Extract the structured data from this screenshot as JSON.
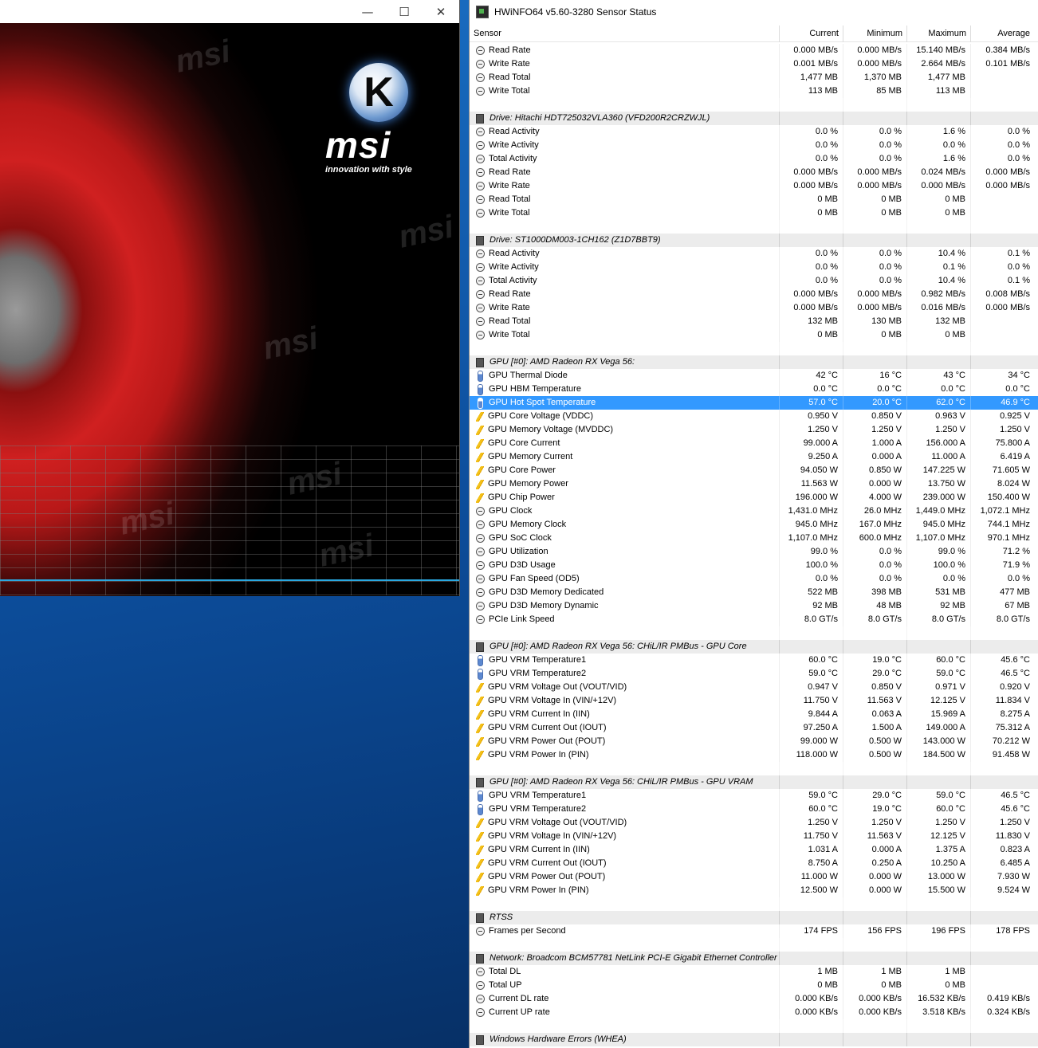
{
  "left_window": {
    "minimize": "—",
    "maximize": "☐",
    "close": "✕",
    "logo_letter": "K",
    "logo_brand": "msi",
    "logo_tagline": "innovation with style",
    "watermark": "msi"
  },
  "hwinfo": {
    "title": "HWiNFO64 v5.60-3280 Sensor Status",
    "columns": [
      "Sensor",
      "Current",
      "Minimum",
      "Maximum",
      "Average"
    ],
    "rows": [
      {
        "t": "s",
        "i": "clock",
        "n": "Read Rate",
        "v": [
          "0.000 MB/s",
          "0.000 MB/s",
          "15.140 MB/s",
          "0.384 MB/s"
        ]
      },
      {
        "t": "s",
        "i": "clock",
        "n": "Write Rate",
        "v": [
          "0.001 MB/s",
          "0.000 MB/s",
          "2.664 MB/s",
          "0.101 MB/s"
        ]
      },
      {
        "t": "s",
        "i": "clock",
        "n": "Read Total",
        "v": [
          "1,477 MB",
          "1,370 MB",
          "1,477 MB",
          ""
        ]
      },
      {
        "t": "s",
        "i": "clock",
        "n": "Write Total",
        "v": [
          "113 MB",
          "85 MB",
          "113 MB",
          ""
        ]
      },
      {
        "t": "b"
      },
      {
        "t": "g",
        "n": "Drive: Hitachi HDT725032VLA360 (VFD200R2CRZWJL)"
      },
      {
        "t": "s",
        "i": "clock",
        "n": "Read Activity",
        "v": [
          "0.0 %",
          "0.0 %",
          "1.6 %",
          "0.0 %"
        ]
      },
      {
        "t": "s",
        "i": "clock",
        "n": "Write Activity",
        "v": [
          "0.0 %",
          "0.0 %",
          "0.0 %",
          "0.0 %"
        ]
      },
      {
        "t": "s",
        "i": "clock",
        "n": "Total Activity",
        "v": [
          "0.0 %",
          "0.0 %",
          "1.6 %",
          "0.0 %"
        ]
      },
      {
        "t": "s",
        "i": "clock",
        "n": "Read Rate",
        "v": [
          "0.000 MB/s",
          "0.000 MB/s",
          "0.024 MB/s",
          "0.000 MB/s"
        ]
      },
      {
        "t": "s",
        "i": "clock",
        "n": "Write Rate",
        "v": [
          "0.000 MB/s",
          "0.000 MB/s",
          "0.000 MB/s",
          "0.000 MB/s"
        ]
      },
      {
        "t": "s",
        "i": "clock",
        "n": "Read Total",
        "v": [
          "0 MB",
          "0 MB",
          "0 MB",
          ""
        ]
      },
      {
        "t": "s",
        "i": "clock",
        "n": "Write Total",
        "v": [
          "0 MB",
          "0 MB",
          "0 MB",
          ""
        ]
      },
      {
        "t": "b"
      },
      {
        "t": "g",
        "n": "Drive: ST1000DM003-1CH162 (Z1D7BBT9)"
      },
      {
        "t": "s",
        "i": "clock",
        "n": "Read Activity",
        "v": [
          "0.0 %",
          "0.0 %",
          "10.4 %",
          "0.1 %"
        ]
      },
      {
        "t": "s",
        "i": "clock",
        "n": "Write Activity",
        "v": [
          "0.0 %",
          "0.0 %",
          "0.1 %",
          "0.0 %"
        ]
      },
      {
        "t": "s",
        "i": "clock",
        "n": "Total Activity",
        "v": [
          "0.0 %",
          "0.0 %",
          "10.4 %",
          "0.1 %"
        ]
      },
      {
        "t": "s",
        "i": "clock",
        "n": "Read Rate",
        "v": [
          "0.000 MB/s",
          "0.000 MB/s",
          "0.982 MB/s",
          "0.008 MB/s"
        ]
      },
      {
        "t": "s",
        "i": "clock",
        "n": "Write Rate",
        "v": [
          "0.000 MB/s",
          "0.000 MB/s",
          "0.016 MB/s",
          "0.000 MB/s"
        ]
      },
      {
        "t": "s",
        "i": "clock",
        "n": "Read Total",
        "v": [
          "132 MB",
          "130 MB",
          "132 MB",
          ""
        ]
      },
      {
        "t": "s",
        "i": "clock",
        "n": "Write Total",
        "v": [
          "0 MB",
          "0 MB",
          "0 MB",
          ""
        ]
      },
      {
        "t": "b"
      },
      {
        "t": "g",
        "n": "GPU [#0]: AMD Radeon RX Vega 56:"
      },
      {
        "t": "s",
        "i": "temp",
        "n": "GPU Thermal Diode",
        "v": [
          "42 °C",
          "16 °C",
          "43 °C",
          "34 °C"
        ]
      },
      {
        "t": "s",
        "i": "temp",
        "n": "GPU HBM Temperature",
        "v": [
          "0.0 °C",
          "0.0 °C",
          "0.0 °C",
          "0.0 °C"
        ]
      },
      {
        "t": "s",
        "i": "temp",
        "n": "GPU Hot Spot Temperature",
        "v": [
          "57.0 °C",
          "20.0 °C",
          "62.0 °C",
          "46.9 °C"
        ],
        "sel": true
      },
      {
        "t": "s",
        "i": "volt",
        "n": "GPU Core Voltage (VDDC)",
        "v": [
          "0.950 V",
          "0.850 V",
          "0.963 V",
          "0.925 V"
        ]
      },
      {
        "t": "s",
        "i": "volt",
        "n": "GPU Memory Voltage (MVDDC)",
        "v": [
          "1.250 V",
          "1.250 V",
          "1.250 V",
          "1.250 V"
        ]
      },
      {
        "t": "s",
        "i": "volt",
        "n": "GPU Core Current",
        "v": [
          "99.000 A",
          "1.000 A",
          "156.000 A",
          "75.800 A"
        ]
      },
      {
        "t": "s",
        "i": "volt",
        "n": "GPU Memory Current",
        "v": [
          "9.250 A",
          "0.000 A",
          "11.000 A",
          "6.419 A"
        ]
      },
      {
        "t": "s",
        "i": "volt",
        "n": "GPU Core Power",
        "v": [
          "94.050 W",
          "0.850 W",
          "147.225 W",
          "71.605 W"
        ]
      },
      {
        "t": "s",
        "i": "volt",
        "n": "GPU Memory Power",
        "v": [
          "11.563 W",
          "0.000 W",
          "13.750 W",
          "8.024 W"
        ]
      },
      {
        "t": "s",
        "i": "volt",
        "n": "GPU Chip Power",
        "v": [
          "196.000 W",
          "4.000 W",
          "239.000 W",
          "150.400 W"
        ]
      },
      {
        "t": "s",
        "i": "clock",
        "n": "GPU Clock",
        "v": [
          "1,431.0 MHz",
          "26.0 MHz",
          "1,449.0 MHz",
          "1,072.1 MHz"
        ]
      },
      {
        "t": "s",
        "i": "clock",
        "n": "GPU Memory Clock",
        "v": [
          "945.0 MHz",
          "167.0 MHz",
          "945.0 MHz",
          "744.1 MHz"
        ]
      },
      {
        "t": "s",
        "i": "clock",
        "n": "GPU SoC Clock",
        "v": [
          "1,107.0 MHz",
          "600.0 MHz",
          "1,107.0 MHz",
          "970.1 MHz"
        ]
      },
      {
        "t": "s",
        "i": "clock",
        "n": "GPU Utilization",
        "v": [
          "99.0 %",
          "0.0 %",
          "99.0 %",
          "71.2 %"
        ]
      },
      {
        "t": "s",
        "i": "clock",
        "n": "GPU D3D Usage",
        "v": [
          "100.0 %",
          "0.0 %",
          "100.0 %",
          "71.9 %"
        ]
      },
      {
        "t": "s",
        "i": "clock",
        "n": "GPU Fan Speed (OD5)",
        "v": [
          "0.0 %",
          "0.0 %",
          "0.0 %",
          "0.0 %"
        ]
      },
      {
        "t": "s",
        "i": "clock",
        "n": "GPU D3D Memory Dedicated",
        "v": [
          "522 MB",
          "398 MB",
          "531 MB",
          "477 MB"
        ]
      },
      {
        "t": "s",
        "i": "clock",
        "n": "GPU D3D Memory Dynamic",
        "v": [
          "92 MB",
          "48 MB",
          "92 MB",
          "67 MB"
        ]
      },
      {
        "t": "s",
        "i": "clock",
        "n": "PCIe Link Speed",
        "v": [
          "8.0 GT/s",
          "8.0 GT/s",
          "8.0 GT/s",
          "8.0 GT/s"
        ]
      },
      {
        "t": "b"
      },
      {
        "t": "g",
        "n": "GPU [#0]: AMD Radeon RX Vega 56: CHiL/IR PMBus - GPU Core"
      },
      {
        "t": "s",
        "i": "temp",
        "n": "GPU VRM Temperature1",
        "v": [
          "60.0 °C",
          "19.0 °C",
          "60.0 °C",
          "45.6 °C"
        ]
      },
      {
        "t": "s",
        "i": "temp",
        "n": "GPU VRM Temperature2",
        "v": [
          "59.0 °C",
          "29.0 °C",
          "59.0 °C",
          "46.5 °C"
        ]
      },
      {
        "t": "s",
        "i": "volt",
        "n": "GPU VRM Voltage Out (VOUT/VID)",
        "v": [
          "0.947 V",
          "0.850 V",
          "0.971 V",
          "0.920 V"
        ]
      },
      {
        "t": "s",
        "i": "volt",
        "n": "GPU VRM Voltage In (VIN/+12V)",
        "v": [
          "11.750 V",
          "11.563 V",
          "12.125 V",
          "11.834 V"
        ]
      },
      {
        "t": "s",
        "i": "volt",
        "n": "GPU VRM Current In (IIN)",
        "v": [
          "9.844 A",
          "0.063 A",
          "15.969 A",
          "8.275 A"
        ]
      },
      {
        "t": "s",
        "i": "volt",
        "n": "GPU VRM Current Out (IOUT)",
        "v": [
          "97.250 A",
          "1.500 A",
          "149.000 A",
          "75.312 A"
        ]
      },
      {
        "t": "s",
        "i": "volt",
        "n": "GPU VRM Power Out (POUT)",
        "v": [
          "99.000 W",
          "0.500 W",
          "143.000 W",
          "70.212 W"
        ]
      },
      {
        "t": "s",
        "i": "volt",
        "n": "GPU VRM Power In (PIN)",
        "v": [
          "118.000 W",
          "0.500 W",
          "184.500 W",
          "91.458 W"
        ]
      },
      {
        "t": "b"
      },
      {
        "t": "g",
        "n": "GPU [#0]: AMD Radeon RX Vega 56: CHiL/IR PMBus - GPU VRAM"
      },
      {
        "t": "s",
        "i": "temp",
        "n": "GPU VRM Temperature1",
        "v": [
          "59.0 °C",
          "29.0 °C",
          "59.0 °C",
          "46.5 °C"
        ]
      },
      {
        "t": "s",
        "i": "temp",
        "n": "GPU VRM Temperature2",
        "v": [
          "60.0 °C",
          "19.0 °C",
          "60.0 °C",
          "45.6 °C"
        ]
      },
      {
        "t": "s",
        "i": "volt",
        "n": "GPU VRM Voltage Out (VOUT/VID)",
        "v": [
          "1.250 V",
          "1.250 V",
          "1.250 V",
          "1.250 V"
        ]
      },
      {
        "t": "s",
        "i": "volt",
        "n": "GPU VRM Voltage In (VIN/+12V)",
        "v": [
          "11.750 V",
          "11.563 V",
          "12.125 V",
          "11.830 V"
        ]
      },
      {
        "t": "s",
        "i": "volt",
        "n": "GPU VRM Current In (IIN)",
        "v": [
          "1.031 A",
          "0.000 A",
          "1.375 A",
          "0.823 A"
        ]
      },
      {
        "t": "s",
        "i": "volt",
        "n": "GPU VRM Current Out (IOUT)",
        "v": [
          "8.750 A",
          "0.250 A",
          "10.250 A",
          "6.485 A"
        ]
      },
      {
        "t": "s",
        "i": "volt",
        "n": "GPU VRM Power Out (POUT)",
        "v": [
          "11.000 W",
          "0.000 W",
          "13.000 W",
          "7.930 W"
        ]
      },
      {
        "t": "s",
        "i": "volt",
        "n": "GPU VRM Power In (PIN)",
        "v": [
          "12.500 W",
          "0.000 W",
          "15.500 W",
          "9.524 W"
        ]
      },
      {
        "t": "b"
      },
      {
        "t": "g",
        "n": "RTSS"
      },
      {
        "t": "s",
        "i": "clock",
        "n": "Frames per Second",
        "v": [
          "174 FPS",
          "156 FPS",
          "196 FPS",
          "178 FPS"
        ]
      },
      {
        "t": "b"
      },
      {
        "t": "g",
        "n": "Network: Broadcom BCM57781 NetLink PCI-E Gigabit Ethernet Controller"
      },
      {
        "t": "s",
        "i": "clock",
        "n": "Total DL",
        "v": [
          "1 MB",
          "1 MB",
          "1 MB",
          ""
        ]
      },
      {
        "t": "s",
        "i": "clock",
        "n": "Total UP",
        "v": [
          "0 MB",
          "0 MB",
          "0 MB",
          ""
        ]
      },
      {
        "t": "s",
        "i": "clock",
        "n": "Current DL rate",
        "v": [
          "0.000 KB/s",
          "0.000 KB/s",
          "16.532 KB/s",
          "0.419 KB/s"
        ]
      },
      {
        "t": "s",
        "i": "clock",
        "n": "Current UP rate",
        "v": [
          "0.000 KB/s",
          "0.000 KB/s",
          "3.518 KB/s",
          "0.324 KB/s"
        ]
      },
      {
        "t": "b"
      },
      {
        "t": "g",
        "n": "Windows Hardware Errors (WHEA)"
      }
    ]
  }
}
